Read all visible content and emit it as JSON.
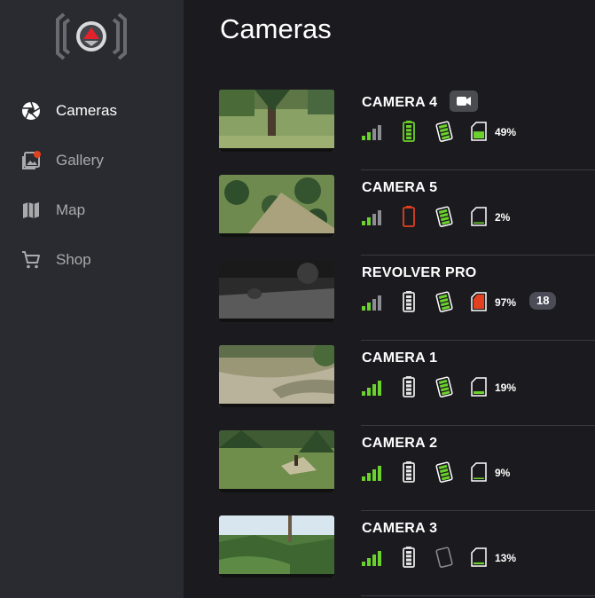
{
  "app": {
    "page_title": "Cameras"
  },
  "sidebar": {
    "items": [
      {
        "label": "Cameras",
        "icon": "aperture-icon",
        "active": true
      },
      {
        "label": "Gallery",
        "icon": "gallery-icon",
        "active": false
      },
      {
        "label": "Map",
        "icon": "map-icon",
        "active": false
      },
      {
        "label": "Shop",
        "icon": "cart-icon",
        "active": false
      }
    ]
  },
  "cameras": [
    {
      "name": "CAMERA 4",
      "has_video": true,
      "signal_bars": 2,
      "battery": "high",
      "battery_color": "#6bd12c",
      "solar": true,
      "sd_level": 0.49,
      "sd_full": false,
      "sd_percent": "49%",
      "new_count": null
    },
    {
      "name": "CAMERA 5",
      "has_video": false,
      "signal_bars": 2,
      "battery": "empty",
      "battery_color": "#e2401f",
      "solar": true,
      "sd_level": 0.02,
      "sd_full": false,
      "sd_percent": "2%",
      "new_count": null
    },
    {
      "name": "REVOLVER PRO",
      "has_video": false,
      "signal_bars": 2,
      "battery": "high",
      "battery_color": "#e6e6e6",
      "solar": true,
      "sd_level": 0.97,
      "sd_full": true,
      "sd_percent": "97%",
      "new_count": "18"
    },
    {
      "name": "CAMERA 1",
      "has_video": false,
      "signal_bars": 4,
      "battery": "high",
      "battery_color": "#e6e6e6",
      "solar": true,
      "sd_level": 0.19,
      "sd_full": false,
      "sd_percent": "19%",
      "new_count": null
    },
    {
      "name": "CAMERA 2",
      "has_video": false,
      "signal_bars": 4,
      "battery": "high",
      "battery_color": "#e6e6e6",
      "solar": true,
      "sd_level": 0.09,
      "sd_full": false,
      "sd_percent": "9%",
      "new_count": null
    },
    {
      "name": "CAMERA 3",
      "has_video": false,
      "signal_bars": 4,
      "battery": "high",
      "battery_color": "#e6e6e6",
      "solar": false,
      "sd_level": 0.13,
      "sd_full": false,
      "sd_percent": "13%",
      "new_count": null
    }
  ],
  "colors": {
    "accent_green": "#6bd12c",
    "alert_red": "#e2401f",
    "inactive_gray": "#8c8d92",
    "sidebar_bg": "#2a2b30",
    "main_bg": "#1b1b1f"
  }
}
